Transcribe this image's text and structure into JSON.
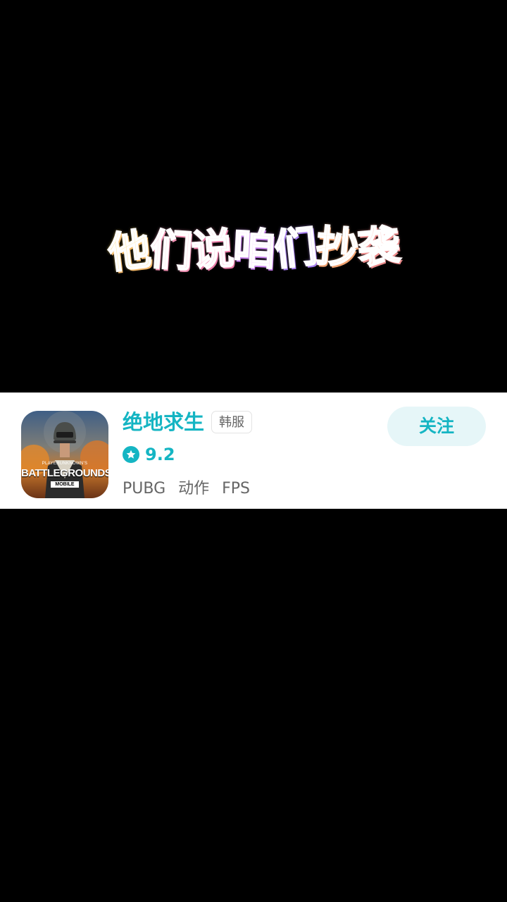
{
  "caption": {
    "chars": [
      "他",
      "们",
      "说",
      "咱",
      "们",
      "抄",
      "袭"
    ]
  },
  "game": {
    "title": "绝地求生",
    "server_badge": "韩服",
    "rating": "9.2",
    "tags": [
      "PUBG",
      "动作",
      "FPS"
    ],
    "follow_label": "关注",
    "icon": {
      "sub_text": "PLAYERUNKNOWN'S",
      "main_text": "BATTLEGROUNDS",
      "badge_text": "MOBILE"
    }
  },
  "colors": {
    "accent": "#15b5c3",
    "follow_bg": "#e6f6f8",
    "background": "#000000",
    "card_bg": "#ffffff"
  }
}
